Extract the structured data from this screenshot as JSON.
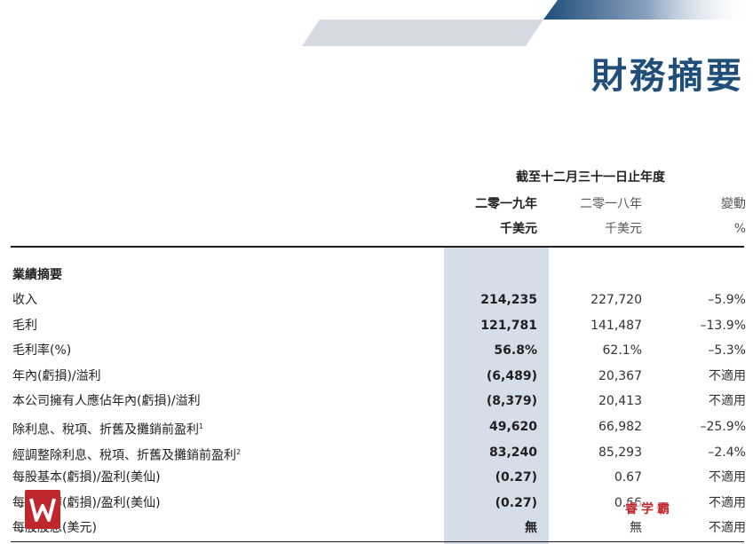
{
  "page_title": "財務摘要",
  "period_header": "截至十二月三十一日止年度",
  "columns": [
    {
      "year": "二零一九年",
      "unit": "千美元"
    },
    {
      "year": "二零一八年",
      "unit": "千美元"
    },
    {
      "year": "變動",
      "unit": "%"
    }
  ],
  "section_title": "業績摘要",
  "rows": [
    {
      "label": "收入",
      "sup": "",
      "v2019": "214,235",
      "v2018": "227,720",
      "change": "–5.9%"
    },
    {
      "label": "毛利",
      "sup": "",
      "v2019": "121,781",
      "v2018": "141,487",
      "change": "–13.9%"
    },
    {
      "label": "毛利率(%)",
      "sup": "",
      "v2019": "56.8%",
      "v2018": "62.1%",
      "change": "–5.3%"
    },
    {
      "label": "年內(虧損)/溢利",
      "sup": "",
      "v2019": "(6,489)",
      "v2018": "20,367",
      "change": "不適用"
    },
    {
      "label": "本公司擁有人應佔年內(虧損)/溢利",
      "sup": "",
      "v2019": "(8,379)",
      "v2018": "20,413",
      "change": "不適用"
    },
    {
      "label": "除利息、稅項、折舊及攤銷前盈利",
      "sup": "1",
      "v2019": "49,620",
      "v2018": "66,982",
      "change": "–25.9%"
    },
    {
      "label": "經調整除利息、稅項、折舊及攤銷前盈利",
      "sup": "2",
      "v2019": "83,240",
      "v2018": "85,293",
      "change": "–2.4%"
    },
    {
      "label": "每股基本(虧損)/盈利(美仙)",
      "sup": "",
      "v2019": "(0.27)",
      "v2018": "0.67",
      "change": "不適用"
    },
    {
      "label": "每股攤薄(虧損)/盈利(美仙)",
      "sup": "",
      "v2019": "(0.27)",
      "v2018": "0.66",
      "change": "不適用"
    },
    {
      "label": "每股股息(美元)",
      "sup": "",
      "v2019": "無",
      "v2018": "無",
      "change": "不適用"
    }
  ],
  "watermark": {
    "logo_icon": "w-logo-icon",
    "text": "睿学霸"
  },
  "colors": {
    "title": "#1f4e79",
    "shade": "#d4dde8",
    "watermark": "#c0272d"
  }
}
